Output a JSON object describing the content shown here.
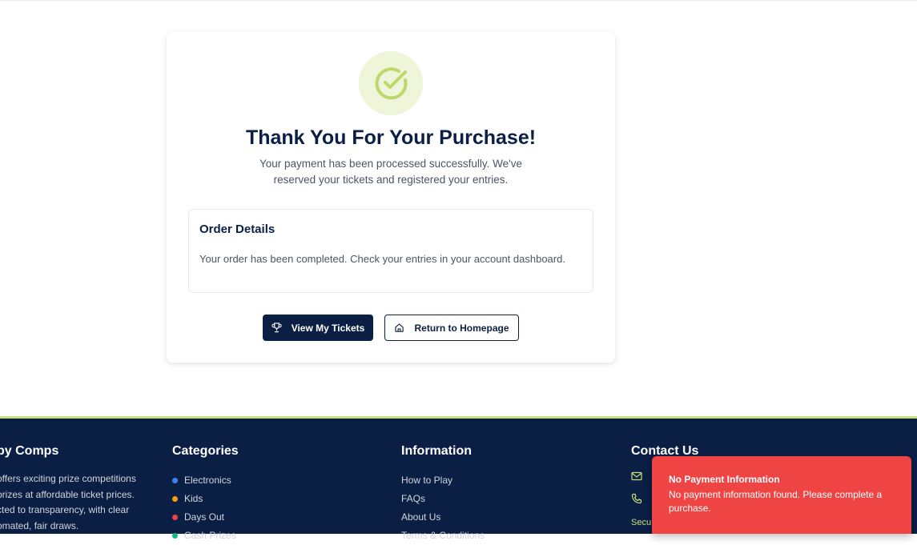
{
  "card": {
    "title": "Thank You For Your Purchase!",
    "subtitle": "Your payment has been processed successfully. We've reserved your tickets and registered your entries.",
    "order": {
      "heading": "Order Details",
      "text": "Your order has been completed. Check your entries in your account dashboard."
    },
    "buttons": {
      "view_tickets": "View My Tickets",
      "return_home": "Return to Homepage"
    },
    "accent_color": "#c8e07a"
  },
  "footer": {
    "about": {
      "heading": "py Comps",
      "text": "offers exciting prize competitions prizes at affordable ticket prices. cted to transparency, with clear omated, fair draws."
    },
    "categories": {
      "heading": "Categories",
      "items": [
        {
          "label": "Electronics",
          "color": "#3b82f6"
        },
        {
          "label": "Kids",
          "color": "#f59e0b"
        },
        {
          "label": "Days Out",
          "color": "#ef4444"
        },
        {
          "label": "Cash Prizes",
          "color": "#10b981"
        }
      ]
    },
    "information": {
      "heading": "Information",
      "items": [
        "How to Play",
        "FAQs",
        "About Us",
        "Terms & Conditions"
      ]
    },
    "contact": {
      "heading": "Contact Us",
      "secure_label": "Secu"
    }
  },
  "toast": {
    "title": "No Payment Information",
    "message": "No payment information found. Please complete a purchase.",
    "color": "#ef4444"
  }
}
